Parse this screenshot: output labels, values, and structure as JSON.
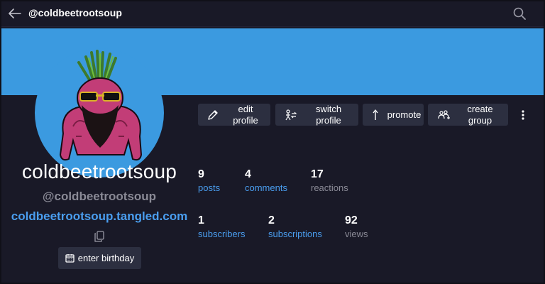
{
  "topbar": {
    "title": "@coldbeetrootsoup",
    "back_icon": "arrow-left-icon",
    "search_icon": "search-icon"
  },
  "colors": {
    "banner": "#3b9ae0",
    "background": "#191927",
    "button": "#2c2f40",
    "link": "#4a9ef0",
    "muted": "#8a8a96"
  },
  "profile": {
    "display_name": "coldbeetrootsoup",
    "handle": "@coldbeetrootsoup",
    "site": "coldbeetrootsoup.tangled.com",
    "birthday_label": "enter birthday"
  },
  "actions": {
    "edit_line1": "edit",
    "edit_line2": "profile",
    "switch_line1": "switch",
    "switch_line2": "profile",
    "promote": "promote",
    "group_line1": "create",
    "group_line2": "group"
  },
  "stats": {
    "posts": {
      "value": "9",
      "label": "posts"
    },
    "comments": {
      "value": "4",
      "label": "comments"
    },
    "reactions": {
      "value": "17",
      "label": "reactions"
    },
    "subscribers": {
      "value": "1",
      "label": "subscribers"
    },
    "subscriptions": {
      "value": "2",
      "label": "subscriptions"
    },
    "views": {
      "value": "92",
      "label": "views"
    }
  }
}
